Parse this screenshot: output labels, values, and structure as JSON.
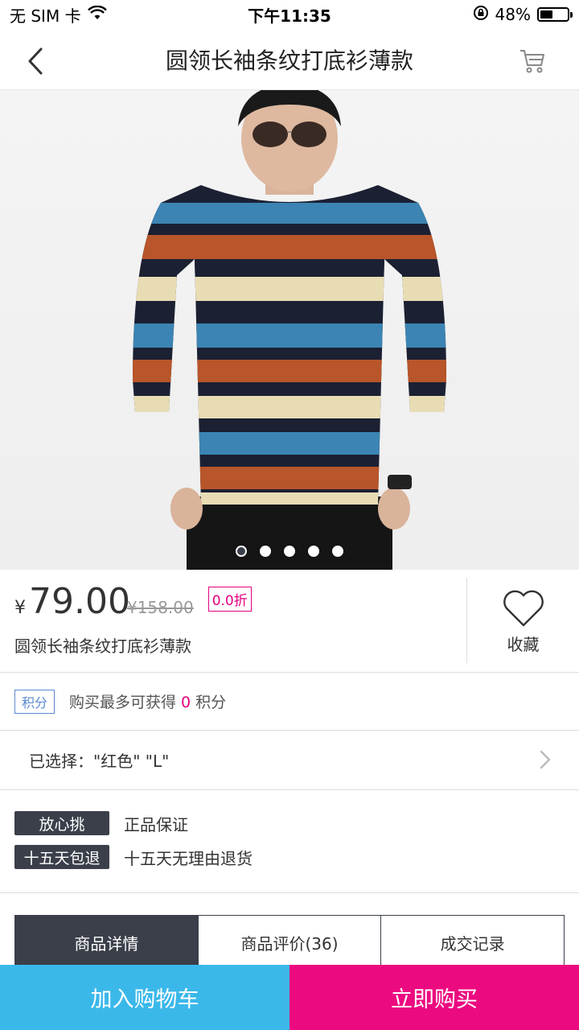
{
  "status_bar": {
    "carrier": "无 SIM 卡",
    "time": "下午11:35",
    "battery": "48%",
    "battery_level": 0.48
  },
  "nav": {
    "title": "圆领长袖条纹打底衫薄款",
    "back_icon": "chevron-left-icon",
    "cart_icon": "cart-icon"
  },
  "carousel": {
    "image": "striped-sweater-model",
    "total": 5,
    "active_index": 0
  },
  "product": {
    "currency": "¥",
    "price": "79.00",
    "old_price": "¥158.00",
    "discount": "0.0折",
    "name": "圆领长袖条纹打底衫薄款"
  },
  "favorite": {
    "label": "收藏",
    "icon": "heart-icon"
  },
  "points": {
    "badge": "积分",
    "prefix": "购买最多可获得",
    "value": "0",
    "suffix": "积分"
  },
  "selection": {
    "text": "已选择：\"红色\" \"L\""
  },
  "guarantees": [
    {
      "badge": "放心挑",
      "text": "正品保证"
    },
    {
      "badge": "十五天包退",
      "text": "十五天无理由退货"
    }
  ],
  "tabs": [
    {
      "label": "商品详情",
      "active": true
    },
    {
      "label": "商品评价(36)",
      "active": false
    },
    {
      "label": "成交记录",
      "active": false
    }
  ],
  "actions": {
    "add_to_cart": "加入购物车",
    "buy_now": "立即购买"
  },
  "colors": {
    "accent_pink": "#e6007e",
    "cart_button": "#3bb8ea",
    "buy_button": "#ec0a80",
    "dark_badge": "#3a3f4a",
    "points_blue": "#5b8bd0"
  }
}
